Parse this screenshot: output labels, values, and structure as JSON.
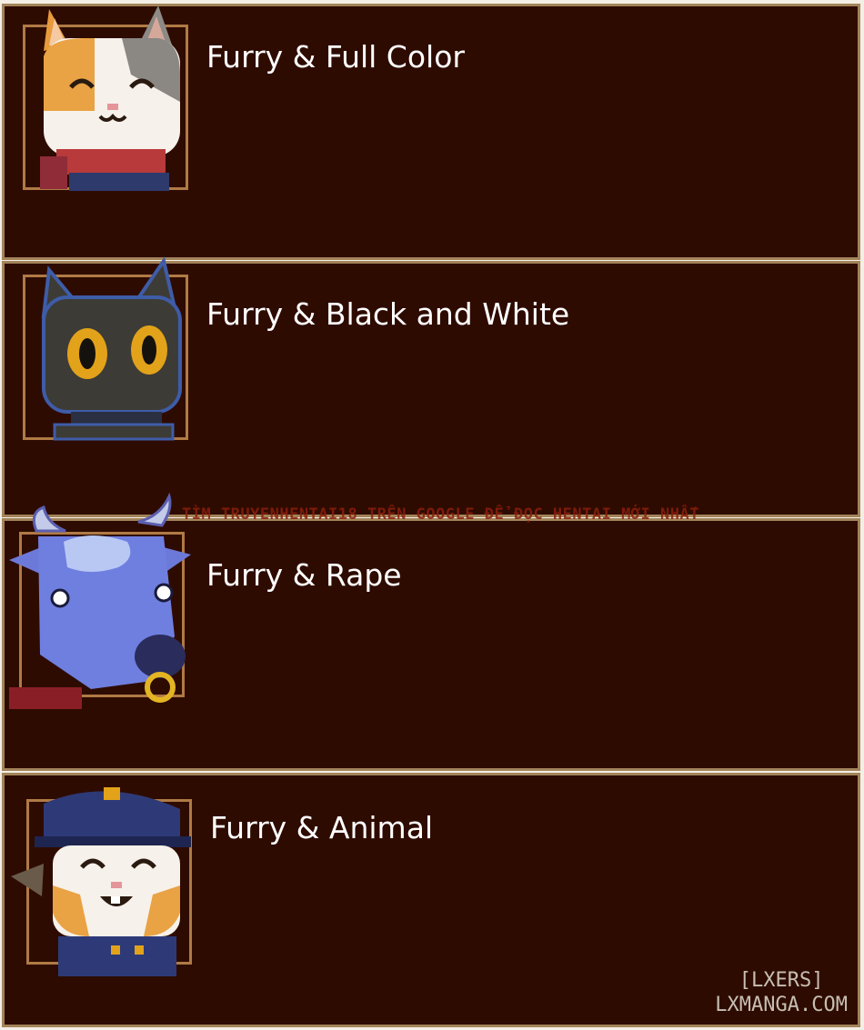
{
  "items": [
    {
      "label": "Furry & Full Color",
      "icon": "calico-cat-icon"
    },
    {
      "label": "Furry & Black and White",
      "icon": "black-cat-icon"
    },
    {
      "label": "Furry & Rape",
      "icon": "blue-bull-icon"
    },
    {
      "label": "Furry & Animal",
      "icon": "cat-officer-icon"
    }
  ],
  "watermark": "TÌM TRUYENHENTAI18 TRÊN GOOGLE ĐỂ ĐỌC HENTAI MỚI NHẤT",
  "brand": {
    "line1": "[LXERS]",
    "line2": "LXMANGA.COM"
  },
  "colors": {
    "card_bg": "#2e0b01",
    "card_border": "#a3845a",
    "portrait_border": "#b07a45",
    "text": "#ffffff"
  }
}
